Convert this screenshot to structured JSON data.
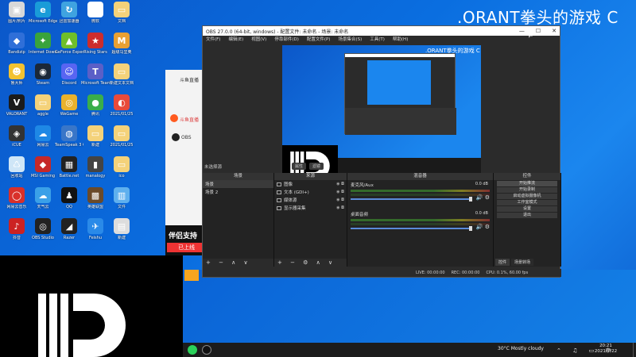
{
  "banner": {
    "title": ".ORANT拳头的游戏 C"
  },
  "desktop_icons": [
    {
      "label": "图片/照片",
      "color": "#d8d8d8",
      "glyph": "▣",
      "col": 0,
      "row": 0
    },
    {
      "label": "Microsoft Edge",
      "color": "#1a9cd8",
      "glyph": "e",
      "col": 1,
      "row": 0
    },
    {
      "label": "迅雷加速器",
      "color": "#3fa3e0",
      "glyph": "↻",
      "col": 2,
      "row": 0
    },
    {
      "label": "微软",
      "color": "#ffffff",
      "glyph": "▤",
      "col": 3,
      "row": 0
    },
    {
      "label": "文档",
      "color": "#f4d27a",
      "glyph": "▭",
      "col": 4,
      "row": 0
    },
    {
      "label": "Bandizip",
      "color": "#2f6fd8",
      "glyph": "◆",
      "col": 0,
      "row": 1
    },
    {
      "label": "Internet Download",
      "color": "#39a33b",
      "glyph": "✦",
      "col": 1,
      "row": 1
    },
    {
      "label": "GeForce Experience",
      "color": "#6fbf2a",
      "glyph": "▲",
      "col": 2,
      "row": 1
    },
    {
      "label": "Rising Stars",
      "color": "#cc2d2d",
      "glyph": "★",
      "col": 3,
      "row": 1
    },
    {
      "label": "超级马里奥",
      "color": "#e8a033",
      "glyph": "M",
      "col": 4,
      "row": 1
    },
    {
      "label": "鲁大师",
      "color": "#f2c230",
      "glyph": "☻",
      "col": 0,
      "row": 2
    },
    {
      "label": "Steam",
      "color": "#1b2838",
      "glyph": "◉",
      "col": 1,
      "row": 2
    },
    {
      "label": "Discord",
      "color": "#5865f2",
      "glyph": "☺",
      "col": 2,
      "row": 2
    },
    {
      "label": "Microsoft Teams",
      "color": "#5b5fc7",
      "glyph": "T",
      "col": 3,
      "row": 2
    },
    {
      "label": "新建文本文档",
      "color": "#f4d27a",
      "glyph": "▭",
      "col": 4,
      "row": 2
    },
    {
      "label": "VALORANT",
      "color": "#1b1b1b",
      "glyph": "V",
      "col": 0,
      "row": 3
    },
    {
      "label": "aggle",
      "color": "#f4d27a",
      "glyph": "▭",
      "col": 1,
      "row": 3
    },
    {
      "label": "WeGame",
      "color": "#e9b22c",
      "glyph": "◎",
      "col": 2,
      "row": 3
    },
    {
      "label": "腾讯",
      "color": "#3aae4a",
      "glyph": "●",
      "col": 3,
      "row": 3
    },
    {
      "label": "2021/01/25",
      "color": "#e84a3a",
      "glyph": "◐",
      "col": 4,
      "row": 3
    },
    {
      "label": "iCUE",
      "color": "#333333",
      "glyph": "◈",
      "col": 0,
      "row": 4
    },
    {
      "label": "网易云",
      "color": "#1e88e5",
      "glyph": "☁",
      "col": 1,
      "row": 4
    },
    {
      "label": "TeamSpeak 3 Client",
      "color": "#3976c8",
      "glyph": "◍",
      "col": 2,
      "row": 4
    },
    {
      "label": "新建",
      "color": "#f4d27a",
      "glyph": "▭",
      "col": 3,
      "row": 4
    },
    {
      "label": "2021/01/25",
      "color": "#f4d27a",
      "glyph": "▭",
      "col": 4,
      "row": 4
    },
    {
      "label": "回收站",
      "color": "#cfe6f7",
      "glyph": "♺",
      "col": 0,
      "row": 5
    },
    {
      "label": "MSI Gaming",
      "color": "#c62828",
      "glyph": "◆",
      "col": 1,
      "row": 5
    },
    {
      "label": "Battle.net",
      "color": "#222222",
      "glyph": "▦",
      "col": 2,
      "row": 5
    },
    {
      "label": "manalogy",
      "color": "#444444",
      "glyph": "▮",
      "col": 3,
      "row": 5
    },
    {
      "label": "ico",
      "color": "#f4d27a",
      "glyph": "▭",
      "col": 4,
      "row": 5
    },
    {
      "label": "网易云音乐",
      "color": "#d9302a",
      "glyph": "◯",
      "col": 0,
      "row": 6
    },
    {
      "label": "天气云",
      "color": "#3aa0e8",
      "glyph": "☁",
      "col": 1,
      "row": 6
    },
    {
      "label": "QQ",
      "color": "#111111",
      "glyph": "♟",
      "col": 2,
      "row": 6
    },
    {
      "label": "英雄联盟",
      "color": "#6a4a2a",
      "glyph": "▩",
      "col": 3,
      "row": 6
    },
    {
      "label": "文件",
      "color": "#5fb0ee",
      "glyph": "▥",
      "col": 4,
      "row": 6
    },
    {
      "label": "抖音",
      "color": "#cc2222",
      "glyph": "♪",
      "col": 0,
      "row": 7
    },
    {
      "label": "OBS Studio",
      "color": "#222222",
      "glyph": "◎",
      "col": 1,
      "row": 7
    },
    {
      "label": "Razer",
      "color": "#222222",
      "glyph": "◢",
      "col": 2,
      "row": 7
    },
    {
      "label": "Feishu",
      "color": "#2a8ae8",
      "glyph": "✈",
      "col": 3,
      "row": 7
    },
    {
      "label": "新建",
      "color": "#dddddd",
      "glyph": "▤",
      "col": 4,
      "row": 7
    }
  ],
  "douyu": {
    "title": "斗鱼直播",
    "item1": "斗鱼直播",
    "item2": "OBS",
    "ad_line1": "伴侣支持",
    "ad_line2": "已上线"
  },
  "obs": {
    "title": "OBS 27.0.0 (64-bit, windows) - 配置文件: 未命名 - 场景: 未命名",
    "window_buttons": [
      "—",
      "☐",
      "✕"
    ],
    "menu": [
      "文件(F)",
      "编辑(E)",
      "视图(V)",
      "停靠部件(D)",
      "配置文件(P)",
      "场景集合(S)",
      "工具(T)",
      "帮助(H)"
    ],
    "preview_title": ".ORANT拳头的游戏 C",
    "no_source_selected": "未选择源",
    "source_buttons": [
      "属性",
      "滤镜"
    ],
    "docks": {
      "scenes": {
        "title": "场景",
        "items": [
          "场景",
          "场景 2"
        ]
      },
      "sources": {
        "title": "来源",
        "items": [
          "图像",
          "文本 (GDI+)",
          "媒体源",
          "显示器采集"
        ]
      },
      "mixer": {
        "title": "混音器",
        "channels": [
          {
            "name": "麦克风/Aux",
            "db": "0.0 dB"
          },
          {
            "name": "桌面音频",
            "db": "0.0 dB"
          }
        ]
      },
      "controls": {
        "title": "控件",
        "buttons": [
          "开始推流",
          "开始录制",
          "启动虚拟摄像机",
          "工作室模式",
          "设置",
          "退出"
        ],
        "tabs": [
          "控件",
          "场景转场"
        ]
      },
      "footer_icons": "+ − ∧ ∨"
    },
    "status": {
      "live": "LIVE: 00:00:00",
      "rec": "REC: 00:00:00",
      "cpu": "CPU: 0.1%, 60.00 fps"
    }
  },
  "taskbar": {
    "weather": "30°C  Mostly cloudy",
    "tray": "⌃ ♫ ▭ 中",
    "time": "20:21",
    "date": "2021/7/22"
  }
}
